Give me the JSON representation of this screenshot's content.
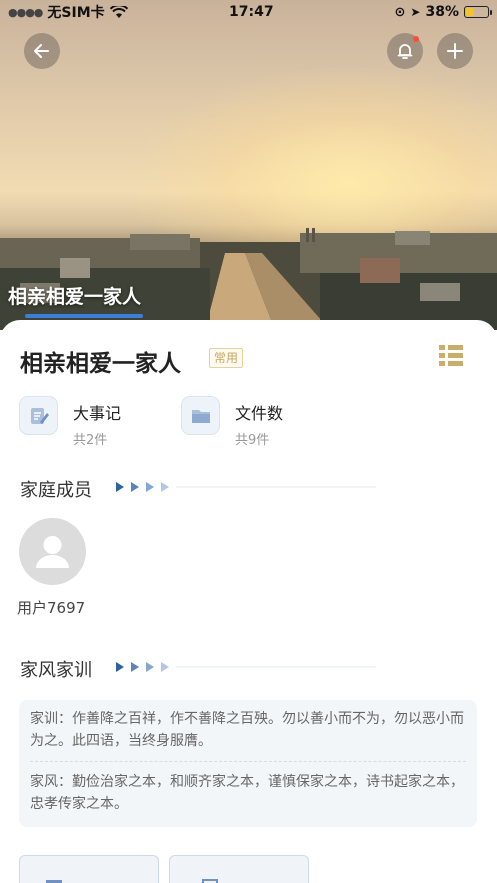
{
  "status_bar": {
    "carrier": "无SIM卡",
    "time": "17:47",
    "battery": "38%",
    "battery_level": 0.38
  },
  "header": {
    "back_icon": "arrow-left-icon",
    "bell_icon": "bell-icon",
    "add_icon": "plus-icon",
    "notification_color": "#ff4d3a"
  },
  "hero": {
    "title": "相亲相爱一家人",
    "accent": "#3b7fd8"
  },
  "family": {
    "name": "相亲相爱一家人",
    "tag": "常用",
    "menu_icon": "list-icon"
  },
  "stats": [
    {
      "label": "大事记",
      "count": "共2件",
      "icon": "edit-note-icon"
    },
    {
      "label": "文件数",
      "count": "共9件",
      "icon": "folder-icon"
    }
  ],
  "sections": {
    "members_title": "家庭成员",
    "motto_title": "家风家训"
  },
  "members": [
    {
      "name": "用户7697",
      "icon": "user-avatar-icon"
    }
  ],
  "motto": {
    "xunshi": "家训：作善降之百祥，作不善降之百殃。勿以善小而不为，勿以恶小而为之。此四语，当终身服膺。",
    "jiafeng": "家风：勤俭治家之本，和顺齐家之本，谨慎保家之本，诗书起家之本，忠孝传家之本。"
  }
}
